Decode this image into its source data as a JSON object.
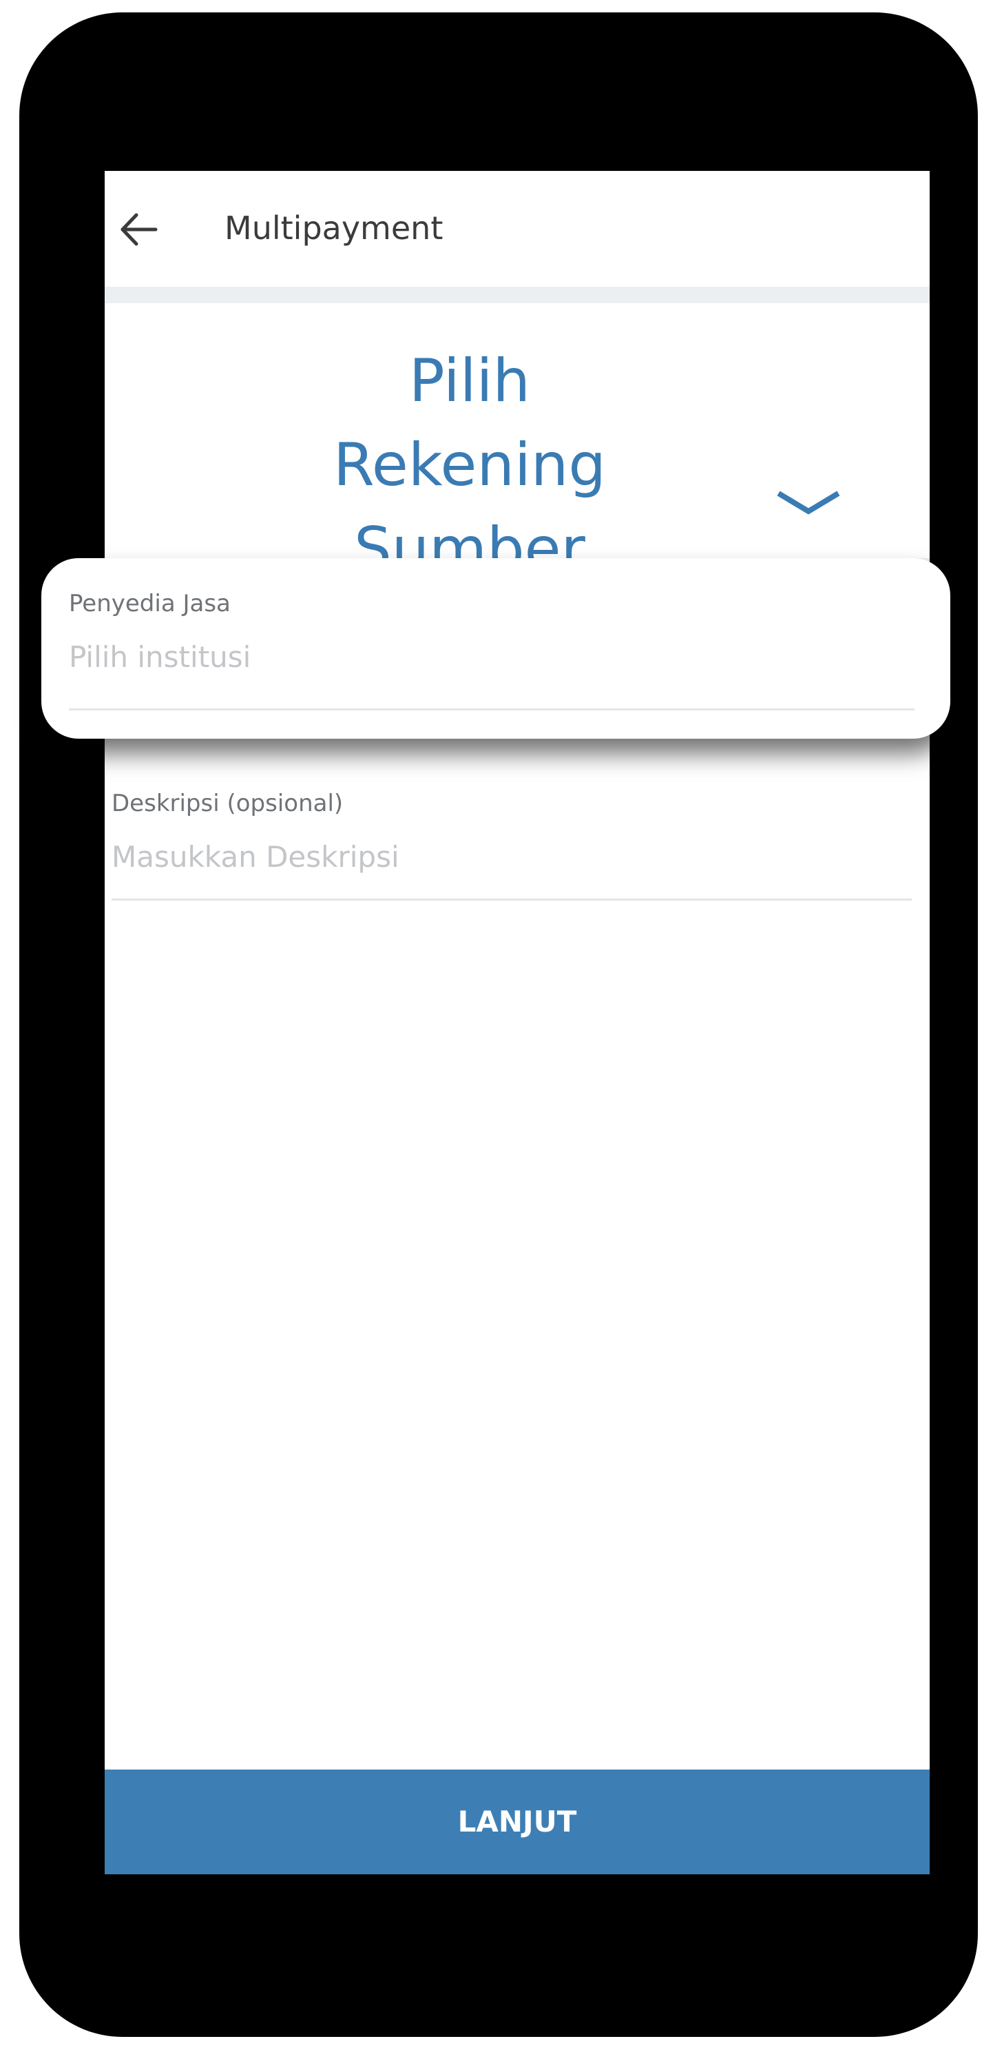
{
  "header": {
    "title": "Multipayment"
  },
  "source_account": {
    "title": "Pilih Rekening Sumber"
  },
  "provider": {
    "label": "Penyedia Jasa",
    "placeholder": "Pilih institusi"
  },
  "description": {
    "label": "Deskripsi (opsional)",
    "placeholder": "Masukkan Deskripsi"
  },
  "footer": {
    "submit_label": "LANJUT"
  },
  "icons": {
    "back": "back-arrow-icon",
    "dropdown": "chevron-down-icon"
  },
  "colors": {
    "accent": "#3d7fb5",
    "title_blue": "#3a7bb3",
    "device_frame": "#000000",
    "divider": "#eceff1"
  }
}
